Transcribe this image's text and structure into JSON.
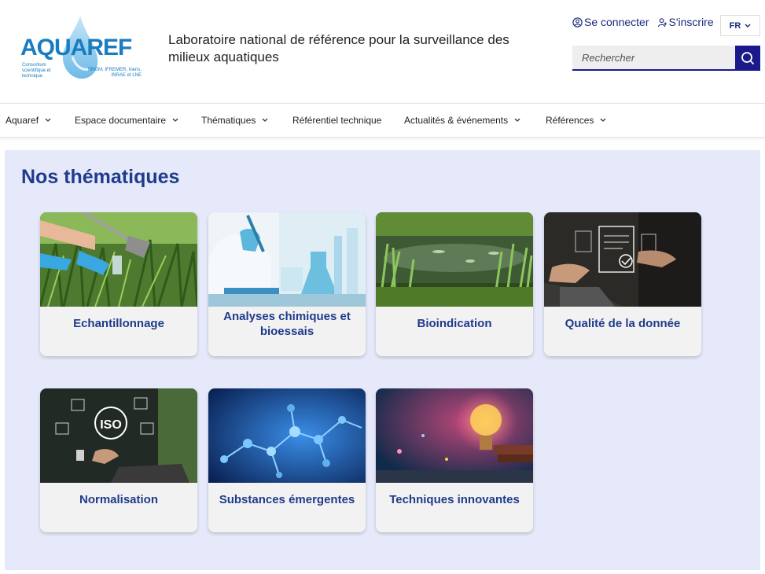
{
  "header": {
    "logo": {
      "word": "AQUAREF",
      "sub_left": "Consortium scientifique et technique",
      "sub_right": "BRGM, IFREMER, Ineris, INRAE et LNE"
    },
    "tagline": "Laboratoire national de référence pour la surveillance des milieux aquatiques",
    "login_label": "Se connecter",
    "signup_label": "S'inscrire",
    "lang": "FR",
    "search_placeholder": "Rechercher"
  },
  "nav": {
    "items": [
      {
        "label": "Aquaref",
        "dropdown": true
      },
      {
        "label": "Espace documentaire",
        "dropdown": true
      },
      {
        "label": "Thématiques",
        "dropdown": true
      },
      {
        "label": "Référentiel technique",
        "dropdown": false
      },
      {
        "label": "Actualités & événements",
        "dropdown": true
      },
      {
        "label": "Références",
        "dropdown": true
      }
    ]
  },
  "main": {
    "title": "Nos thématiques",
    "cards": [
      {
        "label": "Echantillonnage",
        "icon": "sampling-photo"
      },
      {
        "label": "Analyses chimiques et bioessais",
        "icon": "lab-photo"
      },
      {
        "label": "Bioindication",
        "icon": "pond-photo"
      },
      {
        "label": "Qualité de la donnée",
        "icon": "data-quality-photo"
      },
      {
        "label": "Normalisation",
        "icon": "iso-photo"
      },
      {
        "label": "Substances émergentes",
        "icon": "molecules-photo"
      },
      {
        "label": "Techniques innovantes",
        "icon": "lightbulb-photo"
      }
    ]
  },
  "colors": {
    "brand_blue": "#1f3b8c",
    "nav_dark": "#1a1a8a",
    "panel_bg": "#e5e9f9",
    "logo_blue": "#1b7cc0"
  }
}
